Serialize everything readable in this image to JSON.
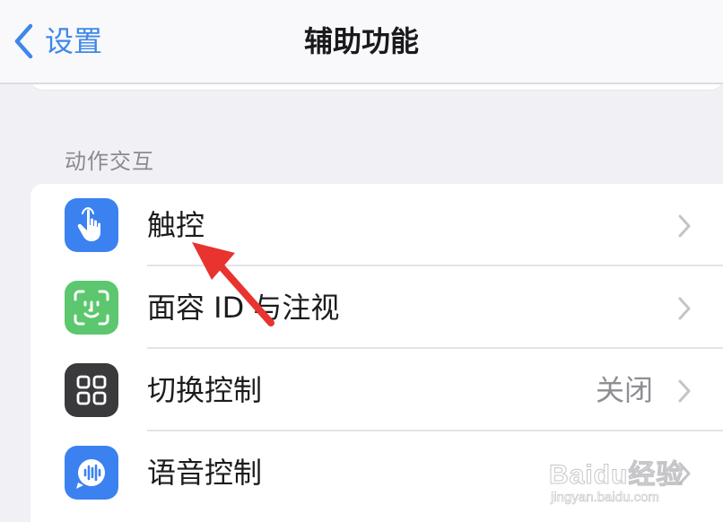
{
  "nav": {
    "back_label": "设置",
    "title": "辅助功能"
  },
  "section": {
    "header": "动作交互"
  },
  "rows": [
    {
      "label": "触控",
      "value": "",
      "icon": "hand-touch-icon",
      "icon_color": "#3b82f0"
    },
    {
      "label": "面容 ID 与注视",
      "value": "",
      "icon": "face-id-icon",
      "icon_color": "#5cc76e"
    },
    {
      "label": "切换控制",
      "value": "关闭",
      "icon": "switch-control-grid-icon",
      "icon_color": "#3a3a3c"
    },
    {
      "label": "语音控制",
      "value": "",
      "icon": "voice-control-icon",
      "icon_color": "#3b82f0"
    }
  ],
  "annotation": {
    "type": "red-arrow",
    "color": "#e8332f"
  },
  "watermark": {
    "main": "Baidu经验",
    "sub": "jingyan.baidu.com"
  },
  "colors": {
    "accent": "#3f87ea",
    "background": "#f1f1f5",
    "card": "#ffffff"
  }
}
